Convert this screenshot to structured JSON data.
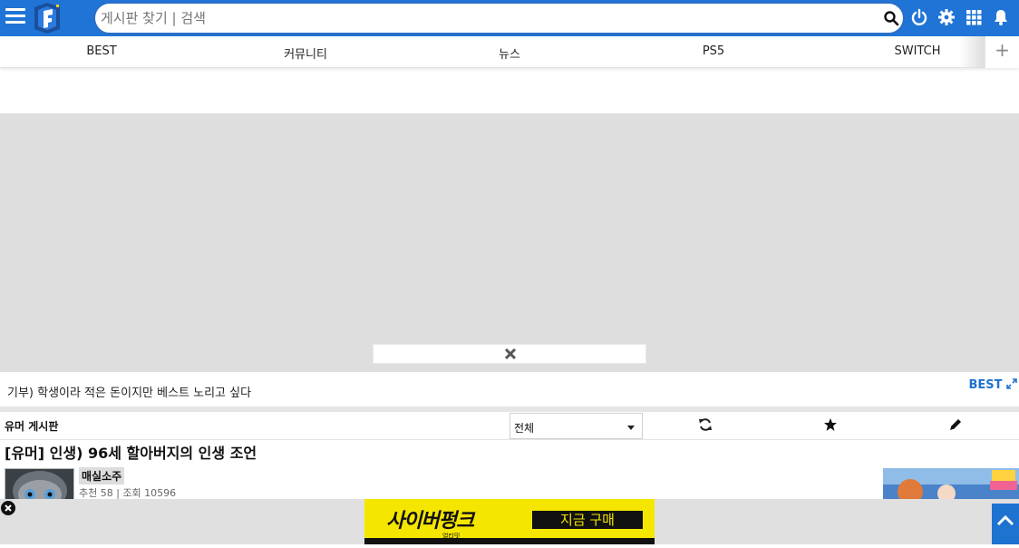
{
  "search": {
    "placeholder": "게시판 찾기 | 검색"
  },
  "tabs": [
    {
      "label": "BEST"
    },
    {
      "label": "커뮤니티"
    },
    {
      "label": "뉴스"
    },
    {
      "label": "PS5"
    },
    {
      "label": "SWITCH"
    }
  ],
  "notice": {
    "text": "기부) 학생이라 적은 돈이지만 베스트 노리고 싶다",
    "best_label": "BEST"
  },
  "board": {
    "name": "유머 게시판",
    "filter_selected": "전체"
  },
  "post": {
    "title": "[유머] 인생) 96세 할아버지의 인생 조언",
    "author": "매실소주",
    "stats": "추천 58 | 조회 10596"
  },
  "banner": {
    "title": "사이버펑크",
    "subtitle": "얼티밋",
    "button_label": "지금 구매"
  },
  "colors": {
    "brand_blue": "#1f74d6",
    "link_blue": "#1e72d0",
    "banner_yellow": "#f5e600"
  }
}
